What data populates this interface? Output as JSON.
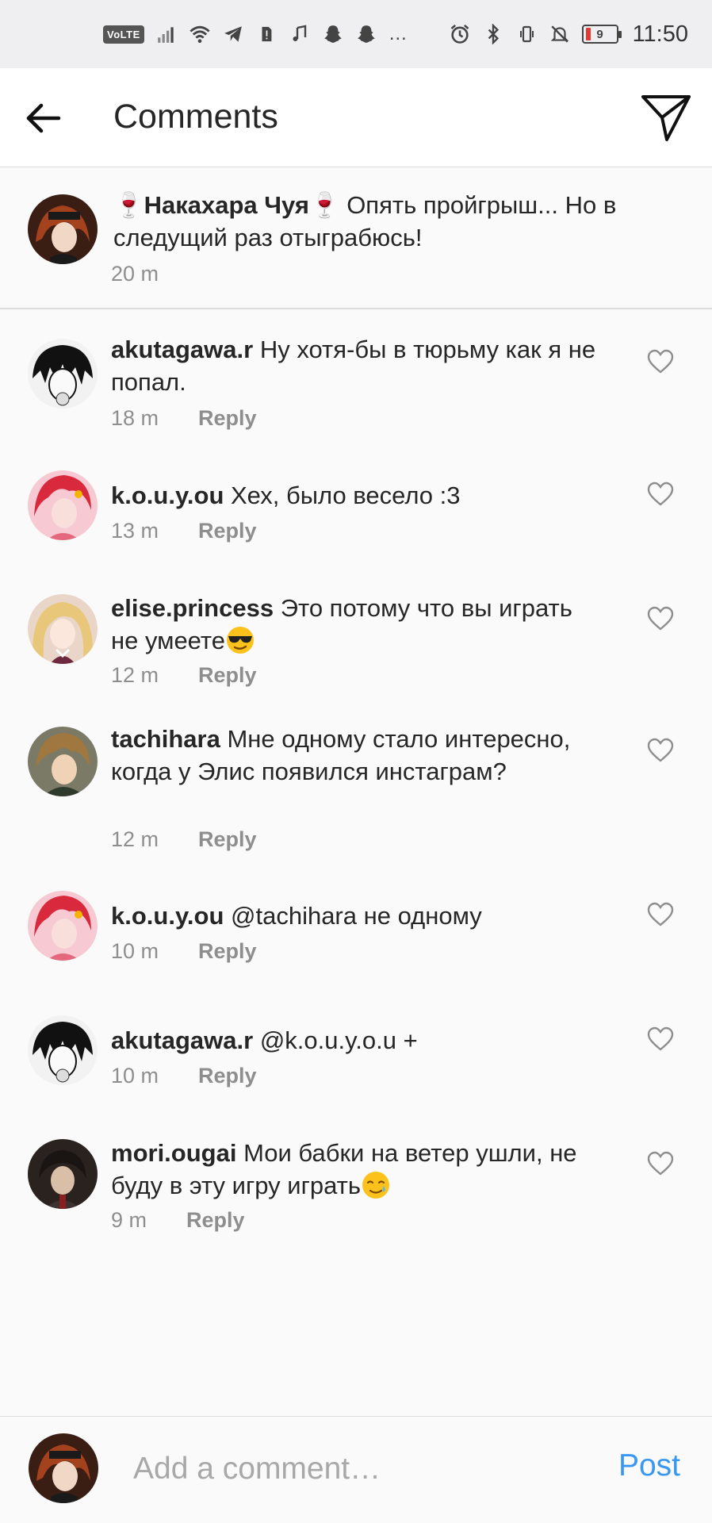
{
  "status_bar": {
    "volte": "VoLTE",
    "battery_level": "9",
    "time": "11:50",
    "more_icon": "…",
    "left_icons": [
      "volte-icon",
      "signal-icon",
      "wifi-icon",
      "telegram-icon",
      "sim-alert-icon",
      "music-note-icon",
      "snapchat-icon",
      "snapchat-icon",
      "more-icon"
    ],
    "right_icons": [
      "alarm-icon",
      "bluetooth-icon",
      "vibrate-icon",
      "mute-icon",
      "battery-icon"
    ]
  },
  "header": {
    "title": "Comments",
    "back_icon": "back-arrow-icon",
    "share_icon": "send-icon"
  },
  "caption": {
    "username_prefix_emoji": "🍷",
    "username": "Накахара Чуя",
    "username_suffix_emoji": "🍷",
    "text": " Опять пройгрыш... Но в следущий раз отыграбюсь!",
    "time": "20 m"
  },
  "comments": [
    {
      "username": "akutagawa.r",
      "text": " Ну хотя-бы в тюрьму как я не попал.",
      "time": "18 m",
      "reply": "Reply",
      "emoji": ""
    },
    {
      "username": "k.o.u.y.ou",
      "text": " Хех, было весело :3",
      "time": "13 m",
      "reply": "Reply",
      "emoji": ""
    },
    {
      "username": "elise.princess",
      "text": " Это потому что вы играть не умеете",
      "time": "12 m",
      "reply": "Reply",
      "emoji": "sunglasses"
    },
    {
      "username": "tachihara",
      "text": " Мне одному стало интересно, когда у Элис появился инстаграм?",
      "time": "12 m",
      "reply": "Reply",
      "emoji": ""
    },
    {
      "username": "k.o.u.y.ou",
      "text": " @tachihara не одному",
      "time": "10 m",
      "reply": "Reply",
      "emoji": ""
    },
    {
      "username": "akutagawa.r",
      "text": " @k.o.u.y.o.u +",
      "time": "10 m",
      "reply": "Reply",
      "emoji": ""
    },
    {
      "username": "mori.ougai",
      "text": " Мои бабки на ветер ушли, не буду в эту игру играть",
      "time": "9 m",
      "reply": "Reply",
      "emoji": "crying-smile"
    }
  ],
  "composer": {
    "placeholder": "Add a comment…",
    "post_label": "Post"
  },
  "colors": {
    "link_blue": "#3897f0",
    "meta_gray": "#8e8e8e",
    "divider": "#dbdbdb",
    "text": "#262626"
  }
}
